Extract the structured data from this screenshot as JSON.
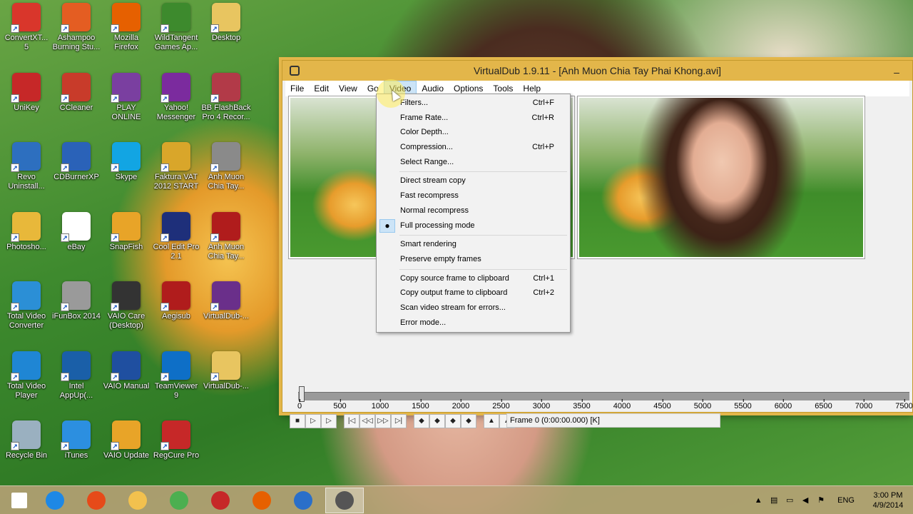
{
  "desktop": {
    "icons": [
      {
        "label": "ConvertXT...\n5",
        "icon": "convertx-icon",
        "color": "#d9362b"
      },
      {
        "label": "Ashampoo\nBurning Stu...",
        "icon": "ashampoo-icon",
        "color": "#e45d22"
      },
      {
        "label": "Mozilla\nFirefox",
        "icon": "firefox-icon",
        "color": "#e66000"
      },
      {
        "label": "WildTangent\nGames Ap...",
        "icon": "wildtangent-icon",
        "color": "#3d8a2d"
      },
      {
        "label": "Desktop",
        "icon": "folder-icon",
        "color": "#e8c560"
      },
      {
        "label": "UniKey",
        "icon": "unikey-icon",
        "color": "#c62828"
      },
      {
        "label": "CCleaner",
        "icon": "ccleaner-icon",
        "color": "#c83b2a"
      },
      {
        "label": "PLAY\nONLINE",
        "icon": "playonline-icon",
        "color": "#7a3fa0"
      },
      {
        "label": "Yahoo!\nMessenger",
        "icon": "yahoo-messenger-icon",
        "color": "#7b2b9e"
      },
      {
        "label": "BB FlashBack\nPro 4 Recor...",
        "icon": "flashback-icon",
        "color": "#b23a48"
      },
      {
        "label": "Revo\nUninstall...",
        "icon": "revo-icon",
        "color": "#2d6fbf"
      },
      {
        "label": "CDBurnerXP",
        "icon": "cdburner-icon",
        "color": "#2a62b8"
      },
      {
        "label": "Skype",
        "icon": "skype-icon",
        "color": "#12a5e3"
      },
      {
        "label": "Faktura VAT\n2012 START",
        "icon": "faktura-icon",
        "color": "#d9a62a"
      },
      {
        "label": "Anh Muon\nChia Tay...",
        "icon": "avi-file-icon",
        "color": "#8a8a8a"
      },
      {
        "label": "Photosho...",
        "icon": "photoshop-folder-icon",
        "color": "#e8b83a"
      },
      {
        "label": "eBay",
        "icon": "ebay-icon",
        "color": "#ffffff"
      },
      {
        "label": "SnapFish",
        "icon": "snapfish-icon",
        "color": "#e8a428"
      },
      {
        "label": "Cool Edit Pro\n2.1",
        "icon": "cooledit-icon",
        "color": "#1e2f7a"
      },
      {
        "label": "Anh Muon\nChia Tay...",
        "icon": "aegisub-file-icon",
        "color": "#b01c1c"
      },
      {
        "label": "Total Video\nConverter",
        "icon": "total-video-converter-icon",
        "color": "#2b8fd6"
      },
      {
        "label": "iFunBox 2014",
        "icon": "ifunbox-icon",
        "color": "#9a9a9a"
      },
      {
        "label": "VAIO Care\n(Desktop)",
        "icon": "vaio-care-icon",
        "color": "#333333"
      },
      {
        "label": "Aegisub",
        "icon": "aegisub-icon",
        "color": "#b01c1c"
      },
      {
        "label": "VirtualDub-...",
        "icon": "winrar-icon",
        "color": "#6a2f8a"
      },
      {
        "label": "Total Video\nPlayer",
        "icon": "total-video-player-icon",
        "color": "#1f86d4"
      },
      {
        "label": "Intel\nAppUp(...",
        "icon": "intel-appup-icon",
        "color": "#1a5fa8"
      },
      {
        "label": "VAIO Manual",
        "icon": "vaio-manual-icon",
        "color": "#1f4fa0"
      },
      {
        "label": "TeamViewer\n9",
        "icon": "teamviewer-icon",
        "color": "#0e6fc7"
      },
      {
        "label": "VirtualDub-...",
        "icon": "folder-icon",
        "color": "#e8c560"
      },
      {
        "label": "Recycle Bin",
        "icon": "recycle-bin-icon",
        "color": "#9ab0c0"
      },
      {
        "label": "iTunes",
        "icon": "itunes-icon",
        "color": "#2c8fe0"
      },
      {
        "label": "VAIO Update",
        "icon": "vaio-update-icon",
        "color": "#e8a428"
      },
      {
        "label": "RegCure Pro",
        "icon": "regcure-icon",
        "color": "#c62828"
      }
    ]
  },
  "window": {
    "title": "VirtualDub 1.9.11 - [Anh Muon Chia Tay Phai Khong.avi]",
    "minimize_glyph": "–",
    "menu": [
      "File",
      "Edit",
      "View",
      "Go",
      "Video",
      "Audio",
      "Options",
      "Tools",
      "Help"
    ],
    "active_menu": "Video",
    "timeline_ticks": [
      "0",
      "500",
      "1000",
      "1500",
      "2000",
      "2500",
      "3000",
      "3500",
      "4000",
      "4500",
      "5000",
      "5500",
      "6000",
      "6500",
      "7000",
      "7500"
    ],
    "frame_status": "Frame 0 (0:00:00.000) [K]",
    "toolbar_buttons": [
      {
        "name": "stop-button",
        "glyph": "■"
      },
      {
        "name": "play-input-button",
        "glyph": "▷"
      },
      {
        "name": "play-output-button",
        "glyph": "▷"
      },
      {
        "name": "start-button",
        "glyph": "|◁"
      },
      {
        "name": "back-key-button",
        "glyph": "◁◁"
      },
      {
        "name": "forward-key-button",
        "glyph": "▷▷"
      },
      {
        "name": "end-button",
        "glyph": "▷|"
      },
      {
        "name": "prev-scene-button",
        "glyph": "◆"
      },
      {
        "name": "next-scene-button",
        "glyph": "◆"
      },
      {
        "name": "mark-in-button",
        "glyph": "◆"
      },
      {
        "name": "mark-out-button",
        "glyph": "◆"
      },
      {
        "name": "prev-keyframe-button",
        "glyph": "▲"
      },
      {
        "name": "next-keyframe-button",
        "glyph": "▲"
      }
    ]
  },
  "video_menu": {
    "groups": [
      [
        {
          "label": "Filters...",
          "shortcut": "Ctrl+F"
        },
        {
          "label": "Frame Rate...",
          "shortcut": "Ctrl+R"
        },
        {
          "label": "Color Depth...",
          "shortcut": ""
        },
        {
          "label": "Compression...",
          "shortcut": "Ctrl+P"
        },
        {
          "label": "Select Range...",
          "shortcut": ""
        }
      ],
      [
        {
          "label": "Direct stream copy",
          "shortcut": ""
        },
        {
          "label": "Fast recompress",
          "shortcut": ""
        },
        {
          "label": "Normal recompress",
          "shortcut": ""
        },
        {
          "label": "Full processing mode",
          "shortcut": "",
          "checked": true
        }
      ],
      [
        {
          "label": "Smart rendering",
          "shortcut": ""
        },
        {
          "label": "Preserve empty frames",
          "shortcut": ""
        }
      ],
      [
        {
          "label": "Copy source frame to clipboard",
          "shortcut": "Ctrl+1"
        },
        {
          "label": "Copy output frame to clipboard",
          "shortcut": "Ctrl+2"
        },
        {
          "label": "Scan video stream for errors...",
          "shortcut": ""
        },
        {
          "label": "Error mode...",
          "shortcut": ""
        }
      ]
    ],
    "check_glyph": "●"
  },
  "taskbar": {
    "apps": [
      {
        "name": "start-button",
        "icon": "windows-logo-icon",
        "color": "#ffffff"
      },
      {
        "name": "taskbar-ie",
        "icon": "internet-explorer-icon",
        "color": "#1e88e5"
      },
      {
        "name": "taskbar-office",
        "icon": "office-icon",
        "color": "#e64a19"
      },
      {
        "name": "taskbar-explorer",
        "icon": "file-explorer-icon",
        "color": "#f2c14e"
      },
      {
        "name": "taskbar-chrome",
        "icon": "chrome-icon",
        "color": "#4caf50"
      },
      {
        "name": "taskbar-yahoo",
        "icon": "yahoo-icon",
        "color": "#c62828"
      },
      {
        "name": "taskbar-firefox",
        "icon": "firefox-icon",
        "color": "#e66000"
      },
      {
        "name": "taskbar-media",
        "icon": "media-player-icon",
        "color": "#2a6fc9"
      },
      {
        "name": "taskbar-virtualdub",
        "icon": "virtualdub-icon",
        "color": "#555555"
      }
    ],
    "language": "ENG",
    "time": "3:00 PM",
    "date": "4/9/2014",
    "tray_icons": [
      "chevron-up-icon",
      "network-adapter-icon",
      "battery-icon",
      "volume-icon",
      "flag-icon"
    ]
  }
}
